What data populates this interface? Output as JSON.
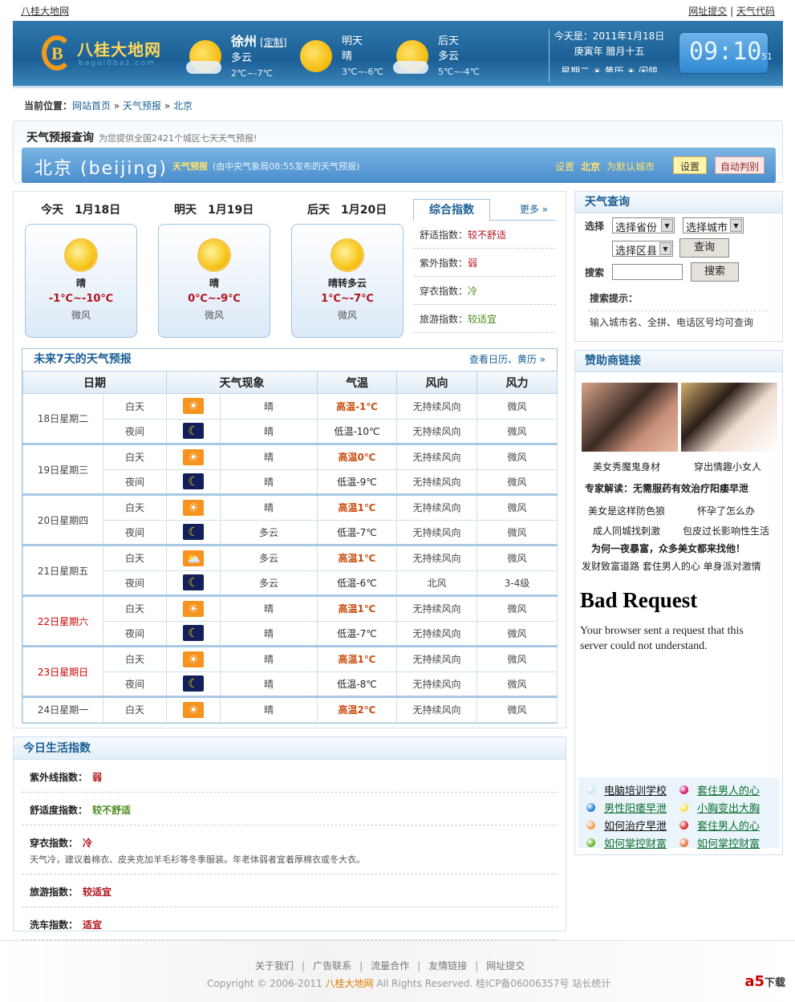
{
  "topbar": {
    "site": "八桂大地网",
    "submit": "网址提交",
    "code": "天气代码",
    "sep": "|"
  },
  "header": {
    "logo_text": "八桂大地网",
    "logo_url": "bagui0ba1.com",
    "today": {
      "city": "徐州",
      "custom": "[定制]",
      "weather": "多云",
      "temp": "2℃~-7℃"
    },
    "tomorrow": {
      "label": "明天",
      "weather": "晴",
      "temp": "3℃~-6℃"
    },
    "after": {
      "label": "后天",
      "weather": "多云",
      "temp": "5℃~-4℃"
    },
    "date_line1": "今天是：2011年1月18日",
    "date_line2": "庚寅年 腊月十五",
    "date_line3": "星期二  ☀ 黄历 ☀ 闲鸽",
    "clock": "09:10",
    "clock_sec": "51"
  },
  "breadcrumb": {
    "label": "当前位置：",
    "items": [
      "网站首页",
      "天气预报",
      "北京"
    ],
    "sep": "»"
  },
  "query": {
    "title": "天气预报查询",
    "subtitle": "为您提供全国2421个城区七天天气预报!",
    "city": "北京 (beijing)",
    "forecast": "天气预报",
    "source": "(由中央气象局08:55发布的天气预报)",
    "set_pre": "设置",
    "set_city": "北京",
    "set_post": "为默认城市",
    "set_btn": "设置",
    "auto_btn": "自动判别"
  },
  "days": [
    {
      "label": "今天",
      "date": "1月18日",
      "weather": "晴",
      "temp": "-1℃~-10℃",
      "wind": "微风"
    },
    {
      "label": "明天",
      "date": "1月19日",
      "weather": "晴",
      "temp": "0℃~-9℃",
      "wind": "微风"
    },
    {
      "label": "后天",
      "date": "1月20日",
      "weather": "晴转多云",
      "temp": "1℃~-7℃",
      "wind": "微风"
    }
  ],
  "index": {
    "tab": "综合指数",
    "more": "更多 »",
    "items": [
      {
        "name": "舒适指数：",
        "value": "较不舒适",
        "color": "#b0121b"
      },
      {
        "name": "紫外指数：",
        "value": "弱",
        "color": "#b0121b"
      },
      {
        "name": "穿衣指数：",
        "value": "冷",
        "color": "#4a8a1a"
      },
      {
        "name": "旅游指数：",
        "value": "较适宜",
        "color": "#4a8a1a"
      }
    ]
  },
  "forecast7": {
    "title": "未来7天的天气预报",
    "link": "查看日历、黄历 »",
    "headers": [
      "日期",
      "天气现象",
      "气温",
      "风向",
      "风力"
    ],
    "rows": [
      {
        "date": "18日星期二",
        "weekend": false,
        "day": {
          "p": "白天",
          "icon": "sun",
          "w": "晴",
          "t": "高温-1℃",
          "d": "无持续风向",
          "f": "微风"
        },
        "night": {
          "p": "夜间",
          "icon": "moon",
          "w": "晴",
          "t": "低温-10℃",
          "d": "无持续风向",
          "f": "微风"
        }
      },
      {
        "date": "19日星期三",
        "weekend": false,
        "day": {
          "p": "白天",
          "icon": "sun",
          "w": "晴",
          "t": "高温0℃",
          "d": "无持续风向",
          "f": "微风"
        },
        "night": {
          "p": "夜间",
          "icon": "moon",
          "w": "晴",
          "t": "低温-9℃",
          "d": "无持续风向",
          "f": "微风"
        }
      },
      {
        "date": "20日星期四",
        "weekend": false,
        "day": {
          "p": "白天",
          "icon": "sun",
          "w": "晴",
          "t": "高温1℃",
          "d": "无持续风向",
          "f": "微风"
        },
        "night": {
          "p": "夜间",
          "icon": "moon-cloud",
          "w": "多云",
          "t": "低温-7℃",
          "d": "无持续风向",
          "f": "微风"
        }
      },
      {
        "date": "21日星期五",
        "weekend": false,
        "day": {
          "p": "白天",
          "icon": "sun-cloud",
          "w": "多云",
          "t": "高温1℃",
          "d": "无持续风向",
          "f": "微风"
        },
        "night": {
          "p": "夜间",
          "icon": "moon-cloud",
          "w": "多云",
          "t": "低温-6℃",
          "d": "北风",
          "f": "3-4级"
        }
      },
      {
        "date": "22日星期六",
        "weekend": true,
        "day": {
          "p": "白天",
          "icon": "sun",
          "w": "晴",
          "t": "高温1℃",
          "d": "无持续风向",
          "f": "微风"
        },
        "night": {
          "p": "夜间",
          "icon": "moon",
          "w": "晴",
          "t": "低温-7℃",
          "d": "无持续风向",
          "f": "微风"
        }
      },
      {
        "date": "23日星期日",
        "weekend": true,
        "day": {
          "p": "白天",
          "icon": "sun",
          "w": "晴",
          "t": "高温1℃",
          "d": "无持续风向",
          "f": "微风"
        },
        "night": {
          "p": "夜间",
          "icon": "moon",
          "w": "晴",
          "t": "低温-8℃",
          "d": "无持续风向",
          "f": "微风"
        }
      },
      {
        "date": "24日星期一",
        "weekend": false,
        "day": {
          "p": "白天",
          "icon": "sun",
          "w": "晴",
          "t": "高温2℃",
          "d": "无持续风向",
          "f": "微风"
        }
      }
    ]
  },
  "search": {
    "title": "天气查询",
    "select_label": "选择",
    "province": "选择省份",
    "city": "选择城市",
    "county": "选择区县",
    "query_btn": "查询",
    "search_label": "搜索",
    "search_value": "",
    "search_btn": "搜索",
    "tip_title": "搜索提示：",
    "tip": "输入城市名、全拼、电话区号均可查询"
  },
  "ads": {
    "title": "赞助商链接",
    "cap1": "美女秀魔鬼身材",
    "cap2": "穿出情趣小女人",
    "headline": "专家解读：无需服药有效治疗阳痿早泄",
    "l1": "美女是这样防色狼",
    "l2": "怀孕了怎么办",
    "l3": "成人同城找刺激",
    "l4": "包皮过长影响性生活",
    "headline2": "为何一夜暴富，众多美女都来找他！",
    "l5": "发财致富道路 套住男人的心 单身派对激情",
    "error_title": "Bad Request",
    "error_text": "Your browser sent a request that this server could not understand.",
    "links": [
      {
        "t": "电脑培训学校",
        "c": "#cfe6f5"
      },
      {
        "t": "套住男人的心",
        "c": "#d81b78"
      },
      {
        "t": "男性阳痿早泄",
        "c": "#2b7fd6"
      },
      {
        "t": "小胸变出大胸",
        "c": "#f2e15a"
      },
      {
        "t": "如何治疗早泄",
        "c": "#f2a04a"
      },
      {
        "t": "套住男人的心",
        "c": "#d83030"
      },
      {
        "t": "如何掌控财富",
        "c": "#6ab52a"
      },
      {
        "t": "如何掌控财富",
        "c": "#e8794a"
      }
    ]
  },
  "life": {
    "title": "今日生活指数",
    "items": [
      {
        "name": "紫外线指数：",
        "value": "弱",
        "color": "#b0121b"
      },
      {
        "name": "舒适度指数：",
        "value": "较不舒适",
        "color": "#4a8a1a"
      },
      {
        "name": "穿衣指数：",
        "value": "冷",
        "color": "#b0121b",
        "desc": "天气冷，建议着棉衣、皮夹克加羊毛衫等冬季服装。年老体弱者宜着厚棉衣或冬大衣。"
      },
      {
        "name": "旅游指数：",
        "value": "较适宜",
        "color": "#b0121b"
      },
      {
        "name": "洗车指数：",
        "value": "适宜",
        "color": "#b0121b"
      }
    ]
  },
  "footer": {
    "links": [
      "关于我们",
      "广告联系",
      "流量合作",
      "友情链接",
      "网址提交"
    ],
    "sep": "|",
    "copy_pre": "Copyright © 2006-2011",
    "copy_site": "八桂大地网",
    "copy_post": "All Rights Reserved. 桂ICP备06006357号 站长统计",
    "badge": "a5",
    "badge_text": "下载"
  }
}
